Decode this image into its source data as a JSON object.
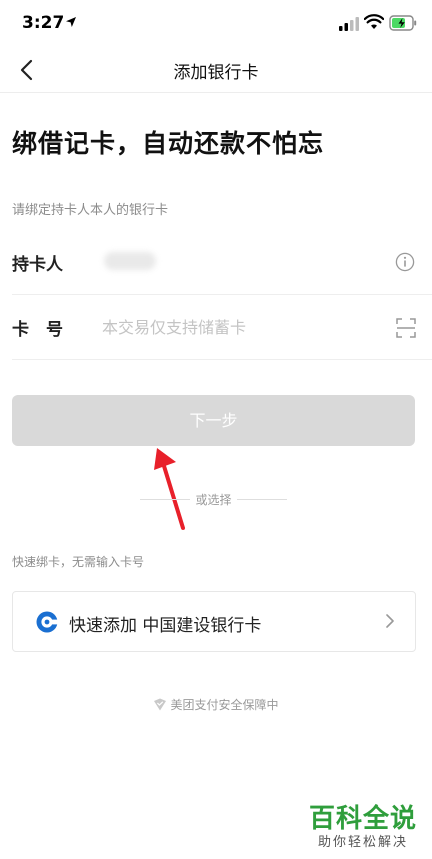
{
  "status_bar": {
    "time": "3:27"
  },
  "nav": {
    "title": "添加银行卡"
  },
  "headline": "绑借记卡，自动还款不怕忘",
  "hint": "请绑定持卡人本人的银行卡",
  "form": {
    "holder_label": "持卡人",
    "card_label": "卡　号",
    "card_placeholder": "本交易仅支持储蓄卡"
  },
  "next_button": "下一步",
  "divider_text": "或选择",
  "quick": {
    "hint": "快速绑卡，无需输入卡号",
    "text": "快速添加  中国建设银行卡"
  },
  "security_text": "美团支付安全保障中",
  "watermark": {
    "main": "百科全说",
    "sub": "助你轻松解决"
  },
  "colors": {
    "accent_blue": "#1a6fd1",
    "button_disabled": "#d9d9d9",
    "annotation_red": "#e8202a",
    "watermark_green": "#2f9e3c"
  },
  "icons": {
    "back": "chevron-left-icon",
    "info": "info-icon",
    "scan": "scan-icon",
    "bank": "ccb-logo-icon",
    "chevron": "chevron-right-icon",
    "shield": "shield-icon"
  }
}
